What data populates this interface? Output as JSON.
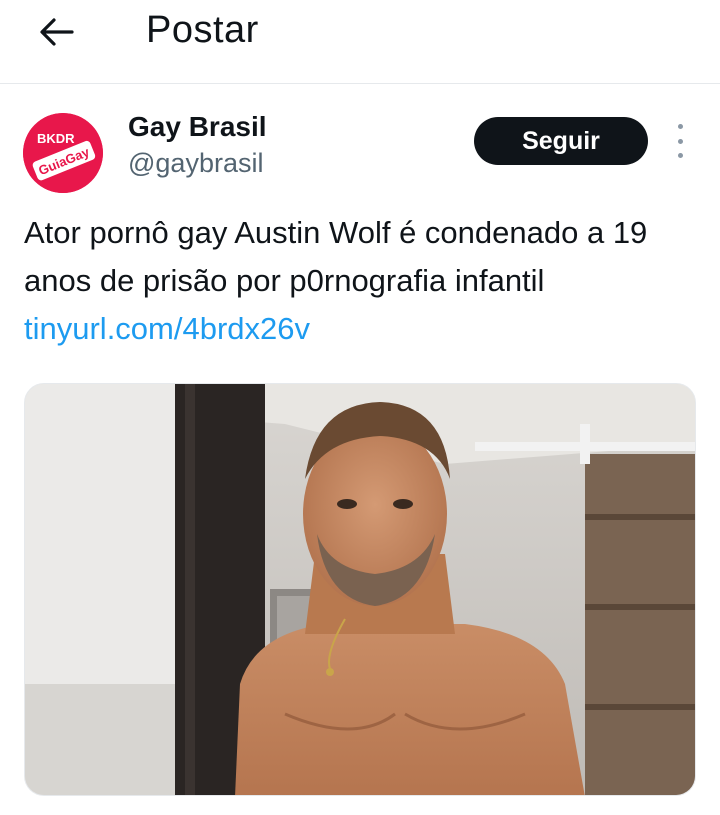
{
  "header": {
    "back_icon": "arrow-left-icon",
    "title": "Postar"
  },
  "post": {
    "author": {
      "name": "Gay Brasil",
      "handle": "@gaybrasil",
      "avatar_text_top": "BKDR",
      "avatar_text_bottom": "GuiaGay",
      "avatar_color": "#e8174b"
    },
    "follow_label": "Seguir",
    "more_icon": "more-vertical-icon",
    "text": "Ator pornô gay Austin Wolf é condenado a 19 anos de prisão por p0rnografia infantil",
    "link": "tinyurl.com/4brdx26v",
    "link_color": "#1d9bf0"
  }
}
